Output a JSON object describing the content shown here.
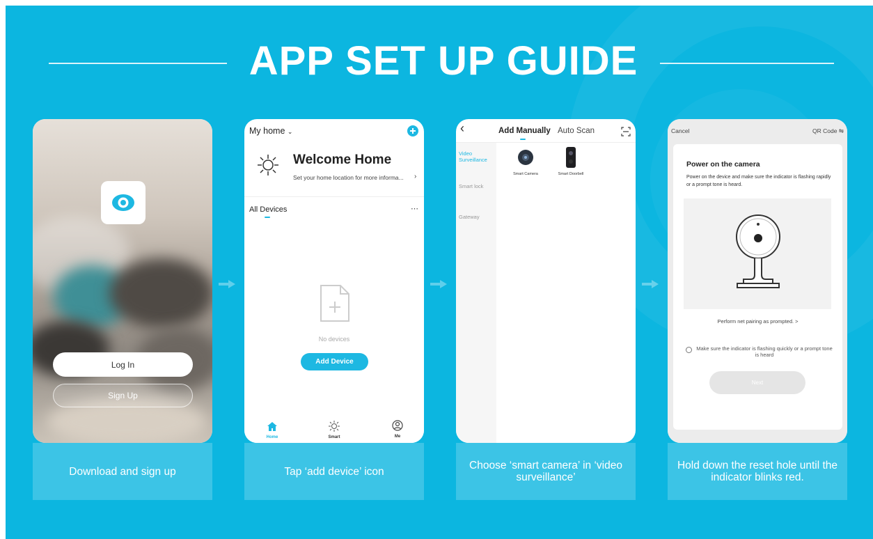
{
  "title": "APP SET UP GUIDE",
  "colors": {
    "accent": "#1db8e2",
    "banner": "#0cb6e0"
  },
  "steps": [
    {
      "caption": "Download and sign up"
    },
    {
      "caption": "Tap ‘add device’ icon"
    },
    {
      "caption": "Choose ‘smart camera’ in ‘video surveillance’"
    },
    {
      "caption": "Hold down the reset hole until the indicator blinks red."
    }
  ],
  "phone1": {
    "login": "Log In",
    "signup": "Sign Up"
  },
  "phone2": {
    "home_selector": "My home",
    "welcome": "Welcome Home",
    "location_hint": "Set your home location for more informa...",
    "all_devices": "All Devices",
    "no_devices": "No devices",
    "add_device": "Add Device",
    "nav": [
      {
        "label": "Home",
        "icon": "home-icon"
      },
      {
        "label": "Smart",
        "icon": "sun-icon"
      },
      {
        "label": "Me",
        "icon": "user-icon"
      }
    ]
  },
  "phone3": {
    "tab_manual": "Add Manually",
    "tab_scan": "Auto Scan",
    "categories": [
      "Video Surveillance",
      "Smart lock",
      "Gateway"
    ],
    "devices": [
      "Smart Camera",
      "Smart Doorbell"
    ]
  },
  "phone4": {
    "cancel": "Cancel",
    "qr": "QR Code",
    "heading": "Power on the camera",
    "instructions": "Power on the device and make sure the indicator is flashing rapidly or a prompt tone is heard.",
    "pairing_link": "Perform net pairing as prompted. >",
    "confirm": "Make sure the indicator is flashing quickly or a prompt tone is heard",
    "next": "Next"
  }
}
